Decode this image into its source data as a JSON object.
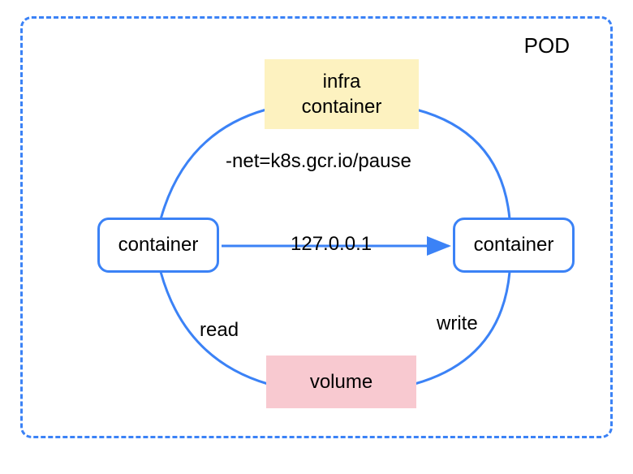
{
  "pod": {
    "label": "POD"
  },
  "infra": {
    "label": "infra\ncontainer"
  },
  "containerLeft": {
    "label": "container"
  },
  "containerRight": {
    "label": "container"
  },
  "volume": {
    "label": "volume"
  },
  "labels": {
    "net": "-net=k8s.gcr.io/pause",
    "ip": "127.0.0.1",
    "read": "read",
    "write": "write"
  }
}
